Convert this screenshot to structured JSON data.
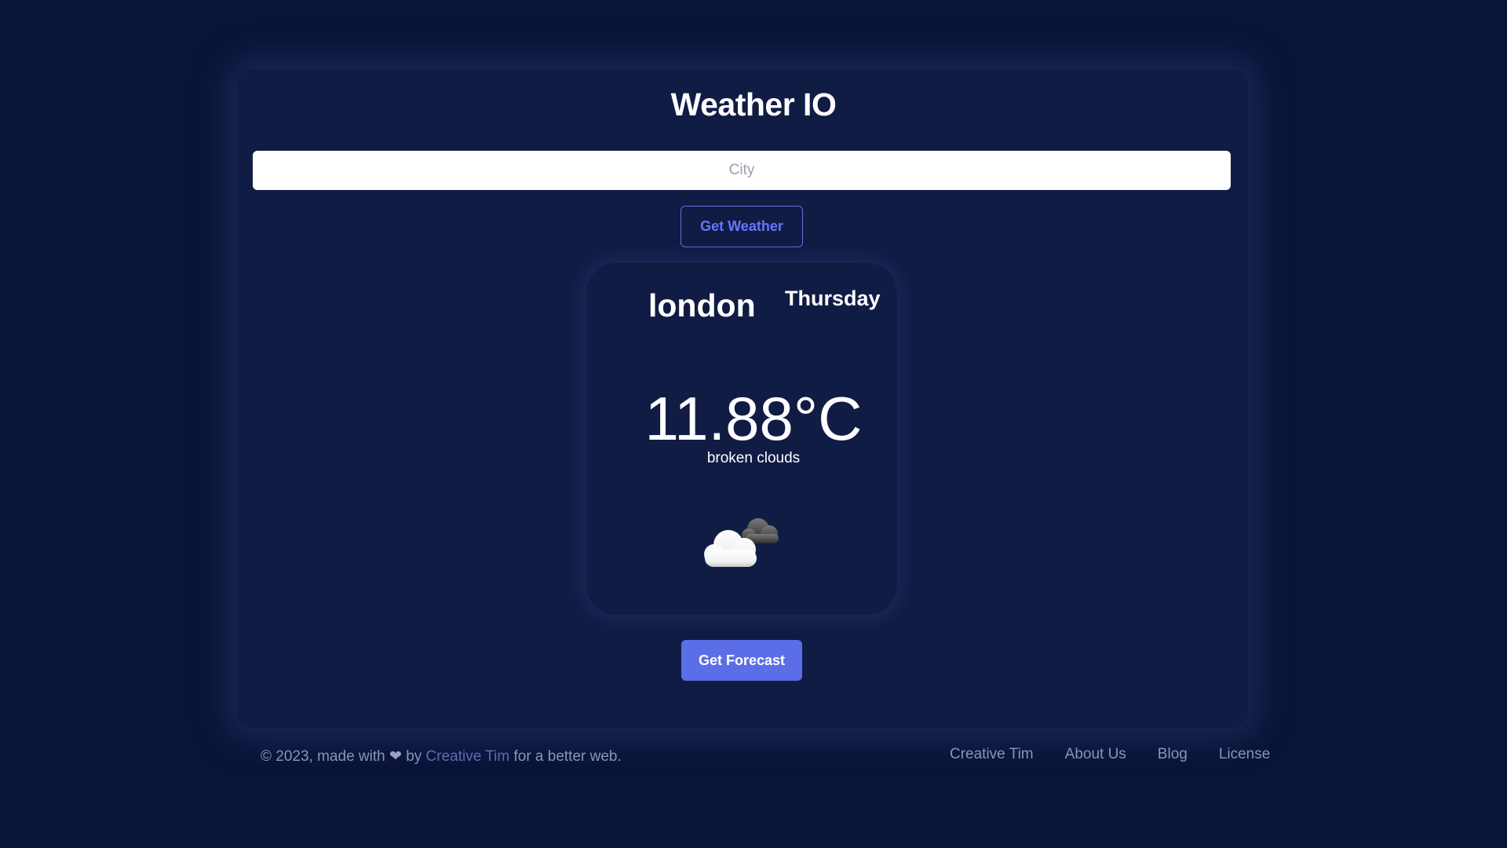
{
  "app": {
    "title": "Weather IO"
  },
  "search": {
    "placeholder": "City",
    "value": ""
  },
  "buttons": {
    "get_weather": "Get Weather",
    "get_forecast": "Get Forecast"
  },
  "weather": {
    "city": "london",
    "day": "Thursday",
    "temperature": "11.88°C",
    "description": "broken clouds",
    "icon": "broken-clouds-icon"
  },
  "footer": {
    "copyright_prefix": "© 2023, made with",
    "heart_icon": "heart-icon",
    "by": "by",
    "author_link": "Creative Tim",
    "copyright_suffix": "for a better web.",
    "nav": [
      "Creative Tim",
      "About Us",
      "Blog",
      "License"
    ]
  },
  "colors": {
    "background": "#0a1438",
    "card": "#111c45",
    "accent": "#5b6ee8",
    "footer_text": "#8a93b8"
  }
}
